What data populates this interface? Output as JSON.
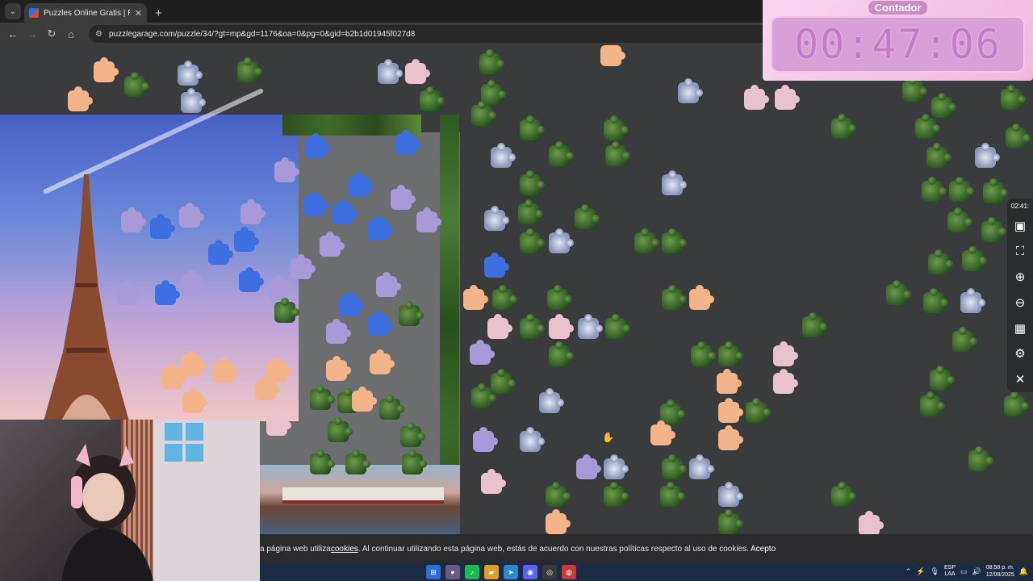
{
  "browser": {
    "tab_title": "Puzzles Online Gratis | Rompec",
    "tab_close": "✕",
    "new_tab": "+",
    "url": "puzzlegarage.com/puzzle/34/?gt=mp&gd=1176&oa=0&pg=0&gid=b2b1d01945f027d8"
  },
  "timer": {
    "label": "Contador",
    "value": "00:47:06"
  },
  "controls": {
    "elapsed": "02:41:"
  },
  "cookie": {
    "text_before": "a página web utiliza ",
    "link": "cookies",
    "text_after": ". Al continuar utilizando esta página web, estás de acuerdo con nuestras políticas respecto al uso de cookies.",
    "accept": "Acepto"
  },
  "taskbar": {
    "lang_top": "ESP",
    "lang_bottom": "LAA",
    "time": "08:58 p. m.",
    "date": "12/08/2025"
  },
  "colors": {
    "board": "#3a3b3d",
    "timer_bg": "#f2b8dc",
    "timer_digits": "#c27dc8",
    "cookie_bg": "#2a2a2d",
    "taskbar": "#1c2a44"
  }
}
